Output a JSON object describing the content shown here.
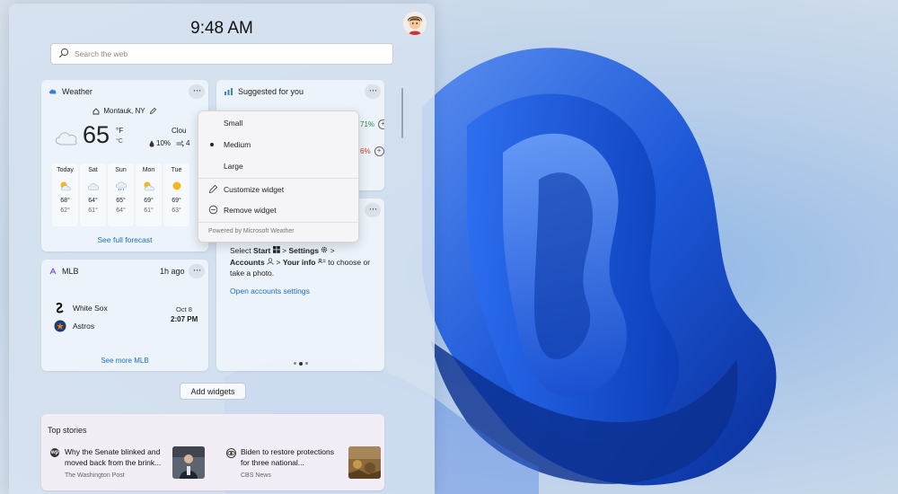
{
  "clock": "9:48 AM",
  "search": {
    "placeholder": "Search the web"
  },
  "weather": {
    "title": "Weather",
    "location": "Montauk, NY",
    "temp": "65",
    "unit_f": "°F",
    "unit_c": "°C",
    "condition": "Clou",
    "precip": "10%",
    "wind_partial": "4",
    "forecast": [
      {
        "day": "Today",
        "icon": "sun-cloud-icon",
        "hi": "68°",
        "lo": "62°"
      },
      {
        "day": "Sat",
        "icon": "cloud-icon",
        "hi": "64°",
        "lo": "61°"
      },
      {
        "day": "Sun",
        "icon": "rain-cloud-icon",
        "hi": "65°",
        "lo": "64°"
      },
      {
        "day": "Mon",
        "icon": "sun-cloud-icon",
        "hi": "69°",
        "lo": "61°"
      },
      {
        "day": "Tue",
        "icon": "sun-icon",
        "hi": "69°",
        "lo": "63°"
      }
    ],
    "link": "See full forecast"
  },
  "suggested": {
    "title": "Suggested for you",
    "rows": [
      {
        "value": "71%",
        "color": "#2e8b3a"
      },
      {
        "value": "6%",
        "color": "#d13a1f"
      }
    ]
  },
  "tips": {
    "line1_pre": "Select",
    "start": "Start",
    "gt1": ">",
    "settings": "Settings",
    "gt2": ">",
    "accounts": "Accounts",
    "gt3": ">",
    "your_info": "Your info",
    "line_end": "to choose or take a photo.",
    "link": "Open accounts settings"
  },
  "mlb": {
    "title": "MLB",
    "ago": "1h ago",
    "teams": [
      "White Sox",
      "Astros"
    ],
    "date": "Oct 8",
    "time": "2:07 PM",
    "link": "See more MLB"
  },
  "add_widgets": "Add widgets",
  "stories": {
    "title": "Top stories",
    "items": [
      {
        "badge": "wp",
        "headline": "Why the Senate blinked and moved back from the brink...",
        "source": "The Washington Post"
      },
      {
        "badge": "",
        "headline": "Biden to restore protections for three national...",
        "source": "CBS News"
      }
    ]
  },
  "menu": {
    "items": [
      "Small",
      "Medium",
      "Large"
    ],
    "selected": "Medium",
    "customize": "Customize widget",
    "remove": "Remove widget",
    "powered": "Powered by Microsoft Weather"
  },
  "colors": {
    "accent": "#1a6fbf",
    "wallpaper_bloom": "#1f5fe0"
  }
}
